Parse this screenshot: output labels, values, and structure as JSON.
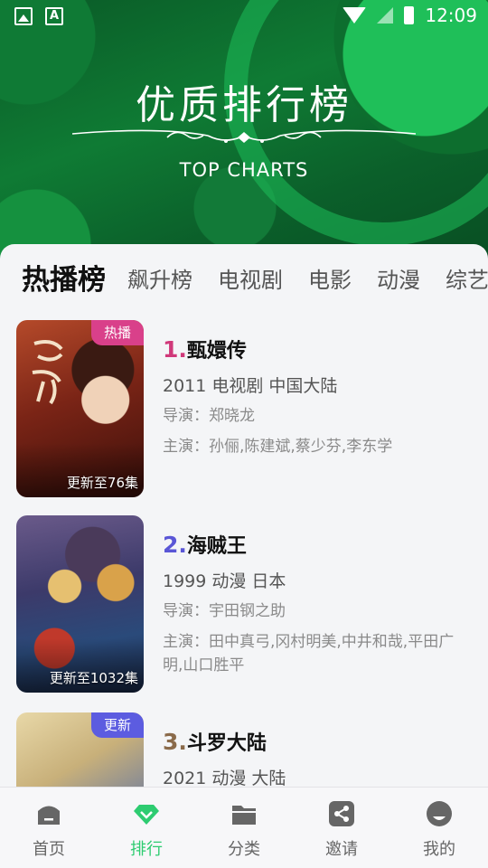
{
  "status": {
    "time": "12:09"
  },
  "hero": {
    "title": "优质排行榜",
    "subtitle": "TOP CHARTS"
  },
  "tabs": [
    {
      "label": "热播榜",
      "active": true
    },
    {
      "label": "飙升榜",
      "active": false
    },
    {
      "label": "电视剧",
      "active": false
    },
    {
      "label": "电影",
      "active": false
    },
    {
      "label": "动漫",
      "active": false
    },
    {
      "label": "综艺",
      "active": false
    }
  ],
  "items": [
    {
      "rank": "1.",
      "rank_color": "#d0397a",
      "title": "甄嬛传",
      "meta": "2011  电视剧  中国大陆",
      "director": "导演：郑晓龙",
      "cast": "主演：孙俪,陈建斌,蔡少芬,李东学",
      "badge": "热播",
      "badge_color": "#d9408a",
      "episodes": "更新至76集"
    },
    {
      "rank": "2.",
      "rank_color": "#5a56d6",
      "title": "海贼王",
      "meta": "1999  动漫  日本",
      "director": "导演：宇田钢之助",
      "cast": "主演：田中真弓,冈村明美,中井和哉,平田广明,山口胜平",
      "badge": "",
      "badge_color": "",
      "episodes": "更新至1032集"
    },
    {
      "rank": "3.",
      "rank_color": "#8a6a4a",
      "title": "斗罗大陆",
      "meta": "2021  动漫  大陆",
      "director": "",
      "cast": "",
      "badge": "更新",
      "badge_color": "#5c5ce0",
      "episodes": ""
    }
  ],
  "nav": [
    {
      "label": "首页",
      "icon": "home-icon",
      "active": false
    },
    {
      "label": "排行",
      "icon": "diamond-icon",
      "active": true
    },
    {
      "label": "分类",
      "icon": "folder-icon",
      "active": false
    },
    {
      "label": "邀请",
      "icon": "share-icon",
      "active": false
    },
    {
      "label": "我的",
      "icon": "profile-icon",
      "active": false
    }
  ],
  "colors": {
    "accent": "#2ecc71",
    "hero_green": "#0f7b34"
  }
}
